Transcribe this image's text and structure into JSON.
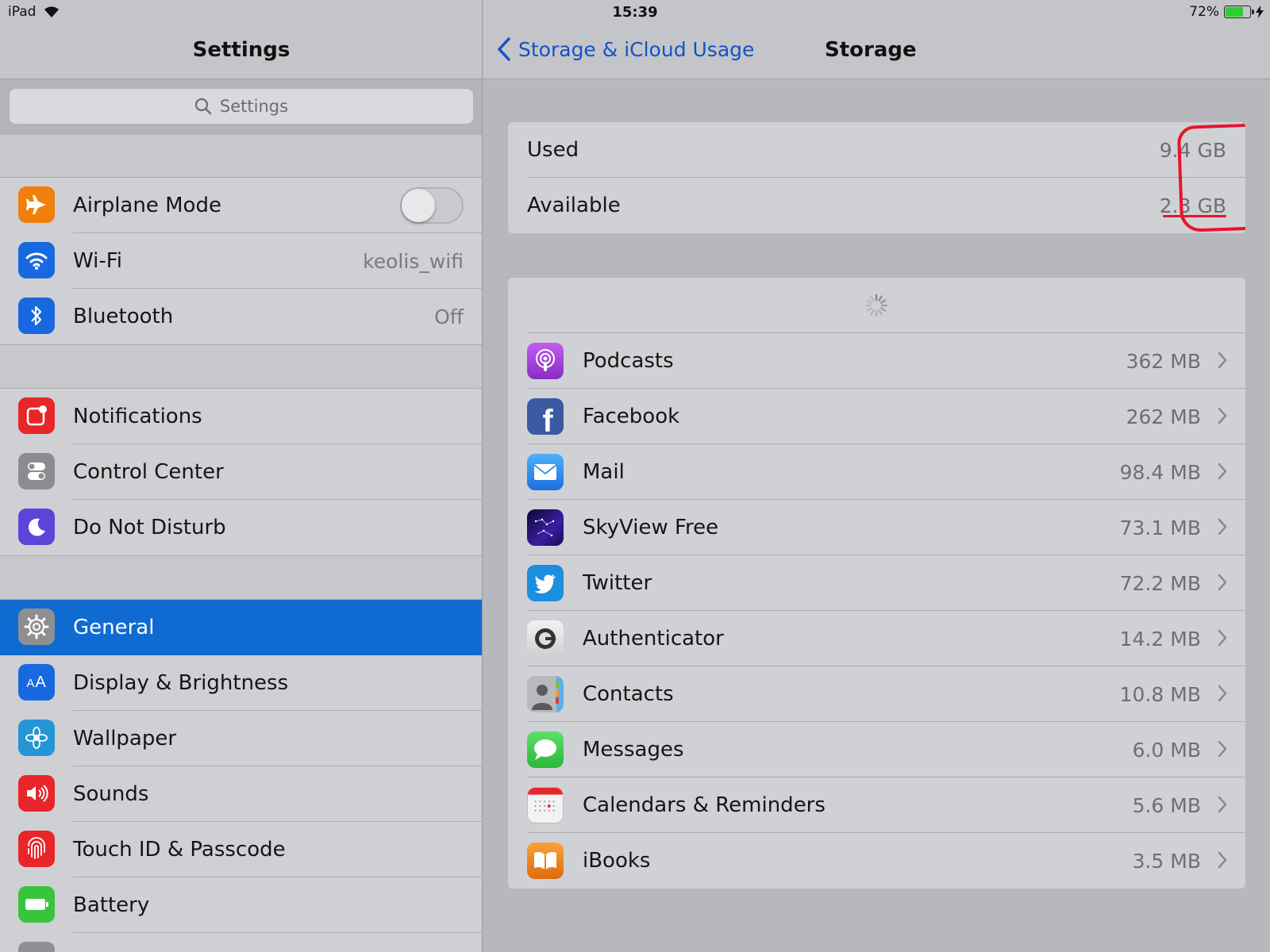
{
  "status_bar": {
    "device": "iPad",
    "time": "15:39",
    "battery": "72%",
    "battery_level": 0.72
  },
  "sidebar": {
    "title": "Settings",
    "search_placeholder": "Settings",
    "groups": [
      [
        {
          "label": "Airplane Mode",
          "icon": "airplane-icon",
          "color": "#f0800e",
          "toggle": false
        },
        {
          "label": "Wi-Fi",
          "icon": "wifi-icon",
          "color": "#1868e0",
          "value": "keolis_wifi"
        },
        {
          "label": "Bluetooth",
          "icon": "bluetooth-icon",
          "color": "#1868e0",
          "value": "Off"
        }
      ],
      [
        {
          "label": "Notifications",
          "icon": "notifications-icon",
          "color": "#e8262a"
        },
        {
          "label": "Control Center",
          "icon": "control-center-icon",
          "color": "#8b8c90"
        },
        {
          "label": "Do Not Disturb",
          "icon": "moon-icon",
          "color": "#5b45d8"
        }
      ],
      [
        {
          "label": "General",
          "icon": "gear-icon",
          "color": "#8e8e93",
          "selected": true
        },
        {
          "label": "Display & Brightness",
          "icon": "display-icon",
          "color": "#1868e0"
        },
        {
          "label": "Wallpaper",
          "icon": "wallpaper-icon",
          "color": "#2496d6"
        },
        {
          "label": "Sounds",
          "icon": "speaker-icon",
          "color": "#e8262a"
        },
        {
          "label": "Touch ID & Passcode",
          "icon": "fingerprint-icon",
          "color": "#e8262a"
        },
        {
          "label": "Battery",
          "icon": "battery-icon",
          "color": "#38c43d"
        }
      ]
    ]
  },
  "detail": {
    "back_label": "Storage & iCloud Usage",
    "title": "Storage",
    "storage": [
      {
        "label": "Used",
        "value": "9.4 GB"
      },
      {
        "label": "Available",
        "value": "2.3 GB"
      }
    ],
    "apps": [
      {
        "label": "Podcasts",
        "value": "362 MB",
        "icon": "podcasts-icon",
        "color": "#9c3dd6"
      },
      {
        "label": "Facebook",
        "value": "262 MB",
        "icon": "facebook-icon",
        "color": "#3b5aa3"
      },
      {
        "label": "Mail",
        "value": "98.4 MB",
        "icon": "mail-icon",
        "color": "#2f8ef0"
      },
      {
        "label": "SkyView Free",
        "value": "73.1 MB",
        "icon": "skyview-icon",
        "color": "#2b1a7e"
      },
      {
        "label": "Twitter",
        "value": "72.2 MB",
        "icon": "twitter-icon",
        "color": "#1da1f2"
      },
      {
        "label": "Authenticator",
        "value": "14.2 MB",
        "icon": "authenticator-icon",
        "color": "#e6e6e6"
      },
      {
        "label": "Contacts",
        "value": "10.8 MB",
        "icon": "contacts-icon",
        "color": "#9a9ba0"
      },
      {
        "label": "Messages",
        "value": "6.0 MB",
        "icon": "messages-icon",
        "color": "#37c84b"
      },
      {
        "label": "Calendars & Reminders",
        "value": "5.6 MB",
        "icon": "calendar-icon",
        "color": "#f2f2f2"
      },
      {
        "label": "iBooks",
        "value": "3.5 MB",
        "icon": "ibooks-icon",
        "color": "#f07e16"
      }
    ]
  }
}
